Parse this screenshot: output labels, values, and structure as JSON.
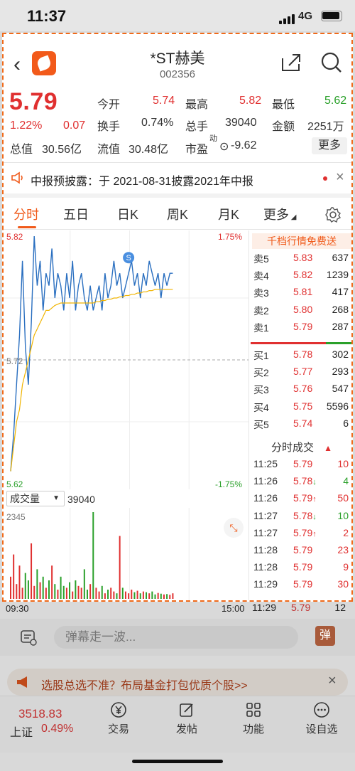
{
  "status": {
    "time": "11:37",
    "network": "4G"
  },
  "header": {
    "name": "*ST赫美",
    "code": "002356"
  },
  "quote": {
    "price": "5.79",
    "change_pct": "1.22%",
    "change_amt": "0.07",
    "labels": {
      "open": "今开",
      "high": "最高",
      "low": "最低",
      "turnover": "换手",
      "volume": "总手",
      "amount": "金额",
      "mcap": "总值",
      "float": "流值",
      "pe": "市盈",
      "pe_sup": "动"
    },
    "values": {
      "open": "5.74",
      "high": "5.82",
      "low": "5.62",
      "turnover": "0.74%",
      "volume": "39040",
      "amount": "2251万",
      "mcap": "30.56亿",
      "float": "30.48亿",
      "pe": "-9.62"
    },
    "more": "更多"
  },
  "notice": {
    "text": "中报预披露：于 2021-08-31披露2021年中报"
  },
  "tabs": [
    "分时",
    "五日",
    "日K",
    "周K",
    "月K",
    "更多"
  ],
  "chart_labels": {
    "high": "5.82",
    "low": "5.62",
    "mid": "5.72",
    "high_pct": "1.75%",
    "low_pct": "-1.75%",
    "vol_label": "成交量",
    "vol_value": "39040",
    "vol_max": "2345",
    "start": "09:30",
    "end": "15:00",
    "marker": "S"
  },
  "chart_data": {
    "type": "line",
    "title": "",
    "xlabel": "",
    "ylabel": "",
    "ylim": [
      5.62,
      5.82
    ],
    "prev_close": 5.72,
    "series": [
      {
        "name": "price",
        "values": [
          5.63,
          5.66,
          5.7,
          5.74,
          5.8,
          5.73,
          5.7,
          5.75,
          5.82,
          5.78,
          5.8,
          5.76,
          5.79,
          5.78,
          5.81,
          5.77,
          5.79,
          5.78,
          5.76,
          5.79,
          5.77,
          5.8,
          5.76,
          5.78,
          5.79,
          5.77,
          5.76,
          5.78,
          5.76,
          5.77,
          5.78,
          5.76,
          5.79,
          5.77,
          5.78,
          5.8,
          5.78,
          5.79,
          5.77,
          5.78,
          5.79,
          5.8,
          5.78,
          5.79,
          5.77,
          5.79,
          5.78,
          5.8,
          5.79,
          5.78,
          5.79,
          5.77,
          5.79,
          5.78,
          5.79,
          5.79
        ]
      },
      {
        "name": "avg",
        "values": [
          5.63,
          5.65,
          5.67,
          5.68,
          5.7,
          5.71,
          5.72,
          5.73,
          5.74,
          5.745,
          5.75,
          5.755,
          5.76,
          5.76,
          5.762,
          5.764,
          5.765,
          5.766,
          5.766,
          5.766,
          5.766,
          5.766,
          5.766,
          5.766,
          5.766,
          5.766,
          5.766,
          5.766,
          5.766,
          5.767,
          5.767,
          5.768,
          5.768,
          5.769,
          5.769,
          5.77,
          5.77,
          5.771,
          5.771,
          5.772,
          5.772,
          5.773,
          5.773,
          5.774,
          5.774,
          5.775,
          5.775,
          5.776,
          5.776,
          5.777,
          5.777,
          5.777,
          5.777,
          5.777,
          5.777,
          5.777
        ]
      }
    ],
    "volume": [
      600,
      1200,
      400,
      900,
      300,
      700,
      500,
      1500,
      350,
      800,
      450,
      600,
      300,
      500,
      900,
      400,
      250,
      600,
      350,
      300,
      450,
      200,
      500,
      350,
      300,
      800,
      250,
      400,
      2345,
      300,
      200,
      350,
      150,
      250,
      300,
      200,
      150,
      1700,
      300,
      200,
      150,
      250,
      180,
      220,
      150,
      200,
      180,
      150,
      200,
      120,
      160,
      140,
      120,
      130,
      110,
      150
    ],
    "x_start": "09:30",
    "x_end": "15:00"
  },
  "orderbook": {
    "promo": "千档行情免费送",
    "asks": [
      {
        "label": "卖5",
        "price": "5.83",
        "vol": "637"
      },
      {
        "label": "卖4",
        "price": "5.82",
        "vol": "1239"
      },
      {
        "label": "卖3",
        "price": "5.81",
        "vol": "417"
      },
      {
        "label": "卖2",
        "price": "5.80",
        "vol": "268"
      },
      {
        "label": "卖1",
        "price": "5.79",
        "vol": "287"
      }
    ],
    "bids": [
      {
        "label": "买1",
        "price": "5.78",
        "vol": "302"
      },
      {
        "label": "买2",
        "price": "5.77",
        "vol": "293"
      },
      {
        "label": "买3",
        "price": "5.76",
        "vol": "547"
      },
      {
        "label": "买4",
        "price": "5.75",
        "vol": "5596"
      },
      {
        "label": "买5",
        "price": "5.74",
        "vol": "6"
      }
    ]
  },
  "trades": {
    "title": "分时成交",
    "rows": [
      {
        "time": "11:25",
        "price": "5.79",
        "arrow": "",
        "vol": "10",
        "color": "#e03030"
      },
      {
        "time": "11:26",
        "price": "5.78",
        "arrow": "↓",
        "vol": "4",
        "color": "#2aa02a"
      },
      {
        "time": "11:26",
        "price": "5.79",
        "arrow": "↑",
        "vol": "50",
        "color": "#e03030"
      },
      {
        "time": "11:27",
        "price": "5.78",
        "arrow": "↓",
        "vol": "10",
        "color": "#2aa02a"
      },
      {
        "time": "11:27",
        "price": "5.79",
        "arrow": "↑",
        "vol": "2",
        "color": "#e03030"
      },
      {
        "time": "11:28",
        "price": "5.79",
        "arrow": "",
        "vol": "23",
        "color": "#e03030"
      },
      {
        "time": "11:28",
        "price": "5.79",
        "arrow": "",
        "vol": "9",
        "color": "#e03030"
      },
      {
        "time": "11:29",
        "price": "5.79",
        "arrow": "",
        "vol": "30",
        "color": "#e03030"
      }
    ],
    "partial": {
      "time": "11:29",
      "price": "5.79",
      "vol": "12"
    }
  },
  "comment": {
    "placeholder": "弹幕走一波...",
    "button": "弹"
  },
  "ad": {
    "text": "选股总选不准？布局基金打包优质个股>>"
  },
  "bottom": {
    "index_value": "3518.83",
    "index_name": "上证",
    "index_pct": "0.49%",
    "items": [
      "交易",
      "发帖",
      "功能",
      "设自选"
    ]
  },
  "colors": {
    "accent": "#f05a1a",
    "up": "#e03030",
    "down": "#2aa02a",
    "line": "#2a6fc0",
    "avg": "#f0b400"
  }
}
